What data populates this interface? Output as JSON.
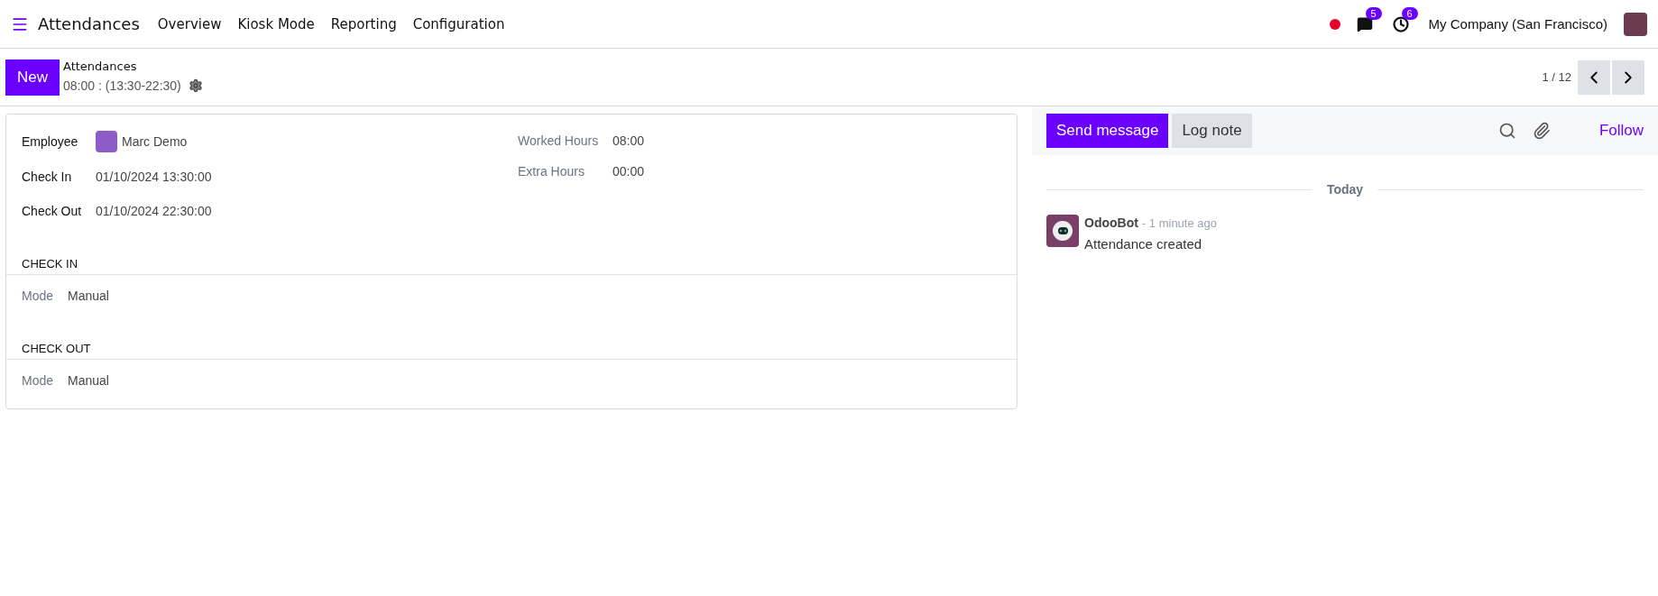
{
  "navbar": {
    "app_title": "Attendances",
    "menu": [
      "Overview",
      "Kiosk Mode",
      "Reporting",
      "Configuration"
    ],
    "messages_count": "5",
    "activities_count": "6",
    "company": "My Company (San Francisco)"
  },
  "control_panel": {
    "new_button": "New",
    "breadcrumb": "Attendances",
    "record_title": "08:00 : (13:30-22:30)",
    "pager": "1 / 12"
  },
  "form": {
    "left_fields": [
      {
        "label": "Employee",
        "value": "Marc Demo",
        "kind": "avatar"
      },
      {
        "label": "Check In",
        "value": "01/10/2024 13:30:00",
        "kind": "text"
      },
      {
        "label": "Check Out",
        "value": "01/10/2024 22:30:00",
        "kind": "text"
      }
    ],
    "right_fields": [
      {
        "label": "Worked Hours",
        "value": "08:00"
      },
      {
        "label": "Extra Hours",
        "value": "00:00"
      }
    ],
    "sections": [
      {
        "title": "CHECK IN",
        "fields": [
          {
            "label": "Mode",
            "value": "Manual"
          }
        ]
      },
      {
        "title": "CHECK OUT",
        "fields": [
          {
            "label": "Mode",
            "value": "Manual"
          }
        ]
      }
    ]
  },
  "chatter": {
    "send_button": "Send message",
    "log_button": "Log note",
    "follow": "Follow",
    "date_separator": "Today",
    "messages": [
      {
        "author": "OdooBot",
        "time": "- 1 minute ago",
        "body": "Attendance created"
      }
    ]
  }
}
